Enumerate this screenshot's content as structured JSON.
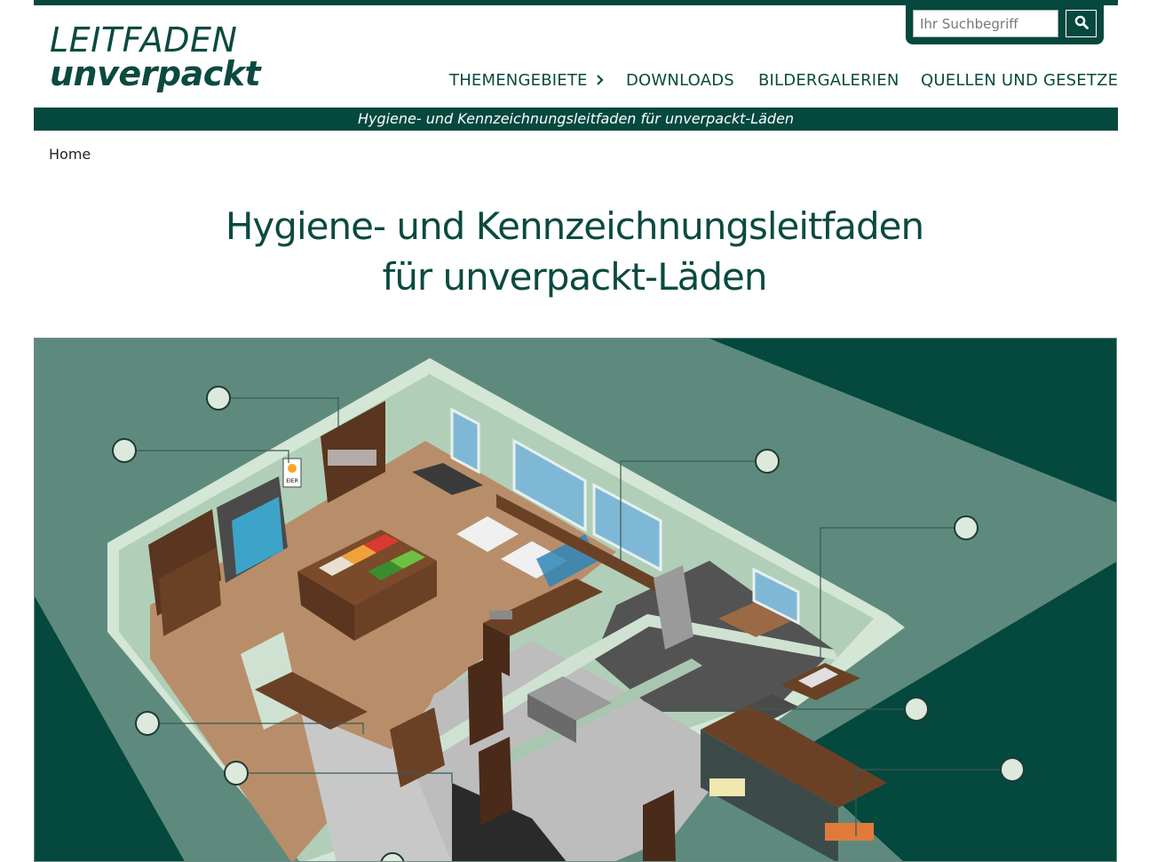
{
  "site": {
    "logo_line1": "LEITFADEN",
    "logo_line2": "unverpackt",
    "subtitle_bar": "Hygiene- und Kennzeichnungsleitfaden für unverpackt-Läden"
  },
  "search": {
    "placeholder": "Ihr Suchbegriff",
    "value": "",
    "button_icon": "search-icon"
  },
  "nav": {
    "items": [
      {
        "label": "THEMENGEBIETE",
        "icon": "chevron-right-icon"
      },
      {
        "label": "DOWNLOADS"
      },
      {
        "label": "BILDERGALERIEN"
      },
      {
        "label": "QUELLEN UND GESETZE"
      }
    ]
  },
  "breadcrumb": {
    "home": "Home"
  },
  "page": {
    "title_line1": "Hygiene- und Kennzeichnungsleitfaden",
    "title_line2": "für unverpackt-Läden"
  },
  "illustration": {
    "egg_sign": "EIER"
  },
  "colors": {
    "brand": "#05483e",
    "background_dark": "#05483e",
    "background_mid": "#5e8a7e",
    "floor_shop": "#b88e6a",
    "floor_storage": "#bfbfbf",
    "floor_kitchen": "#535353",
    "wall": "#cfe2d2",
    "hotspot": "#dde9dc"
  }
}
